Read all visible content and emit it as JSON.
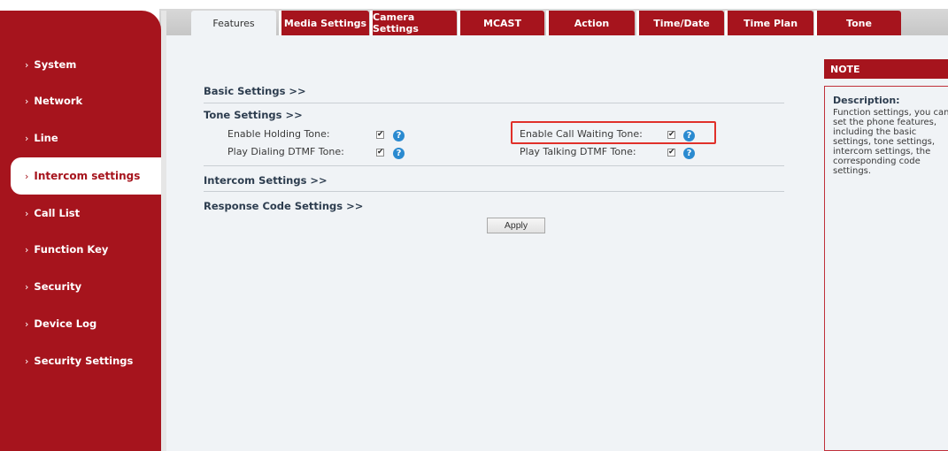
{
  "tabs": [
    {
      "label": "Features",
      "active": true
    },
    {
      "label": "Media Settings",
      "active": false
    },
    {
      "label": "Camera Settings",
      "active": false
    },
    {
      "label": "MCAST",
      "active": false
    },
    {
      "label": "Action",
      "active": false
    },
    {
      "label": "Time/Date",
      "active": false
    },
    {
      "label": "Time Plan",
      "active": false
    },
    {
      "label": "Tone",
      "active": false
    }
  ],
  "sidebar": {
    "items": [
      {
        "label": "System"
      },
      {
        "label": "Network"
      },
      {
        "label": "Line"
      },
      {
        "label": "Intercom settings",
        "active": true
      },
      {
        "label": "Call List"
      },
      {
        "label": "Function Key"
      },
      {
        "label": "Security"
      },
      {
        "label": "Device Log"
      },
      {
        "label": "Security Settings"
      }
    ],
    "arrow": "›"
  },
  "sections": {
    "basic": "Basic Settings >>",
    "tone": "Tone Settings >>",
    "intercom": "Intercom Settings >>",
    "response": "Response Code Settings >>"
  },
  "tone_settings": [
    {
      "label": "Enable Holding Tone:",
      "checked": true
    },
    {
      "label": "Enable Call Waiting Tone:",
      "checked": true
    },
    {
      "label": "Play Dialing DTMF Tone:",
      "checked": true
    },
    {
      "label": "Play Talking DTMF Tone:",
      "checked": true
    }
  ],
  "help_glyph": "?",
  "check_glyph": "✔",
  "apply_label": "Apply",
  "note": {
    "header": "NOTE",
    "title": "Description:",
    "text": "Function settings, you can set the phone features, including the basic settings, tone settings, intercom settings, the corresponding code settings."
  },
  "colors": {
    "brand": "#a6141d",
    "highlight": "#e0302a",
    "help": "#2a8ad0"
  }
}
